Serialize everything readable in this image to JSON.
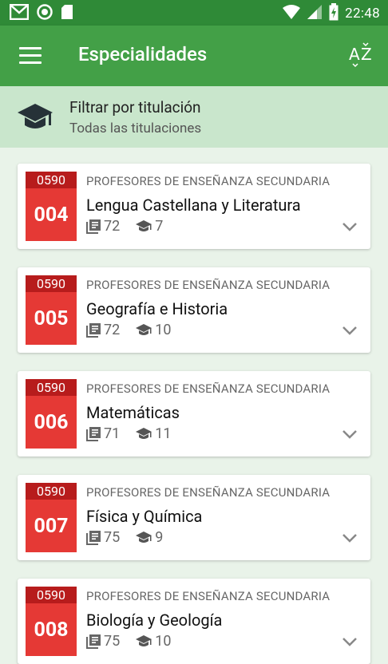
{
  "status_bar": {
    "time": "22:48",
    "icons": [
      "gmail-icon",
      "record-icon",
      "sd-card-icon",
      "wifi-icon",
      "signal-icon",
      "battery-charging-icon"
    ]
  },
  "app_bar": {
    "title": "Especialidades",
    "menu_icon": "hamburger-menu-icon",
    "sort_label": "AZ"
  },
  "filter": {
    "icon": "graduation-cap-icon",
    "title": "Filtrar por titulación",
    "subtitle": "Todas las titulaciones"
  },
  "colors": {
    "status_bar": "#2f8a37",
    "app_bar": "#43a047",
    "filter_bg": "#c9e6cc",
    "badge": "#e53935",
    "badge_header": "#b71c1c"
  },
  "specialties": [
    {
      "group_code": "0590",
      "code": "004",
      "category": "PROFESORES DE ENSEÑANZA SECUNDARIA",
      "name": "Lengua Castellana y Literatura",
      "topics": "72",
      "degrees": "7"
    },
    {
      "group_code": "0590",
      "code": "005",
      "category": "PROFESORES DE ENSEÑANZA SECUNDARIA",
      "name": "Geografía e Historia",
      "topics": "72",
      "degrees": "10"
    },
    {
      "group_code": "0590",
      "code": "006",
      "category": "PROFESORES DE ENSEÑANZA SECUNDARIA",
      "name": "Matemáticas",
      "topics": "71",
      "degrees": "11"
    },
    {
      "group_code": "0590",
      "code": "007",
      "category": "PROFESORES DE ENSEÑANZA SECUNDARIA",
      "name": "Física y Química",
      "topics": "75",
      "degrees": "9"
    },
    {
      "group_code": "0590",
      "code": "008",
      "category": "PROFESORES DE ENSEÑANZA SECUNDARIA",
      "name": "Biología y Geología",
      "topics": "75",
      "degrees": "10"
    }
  ]
}
